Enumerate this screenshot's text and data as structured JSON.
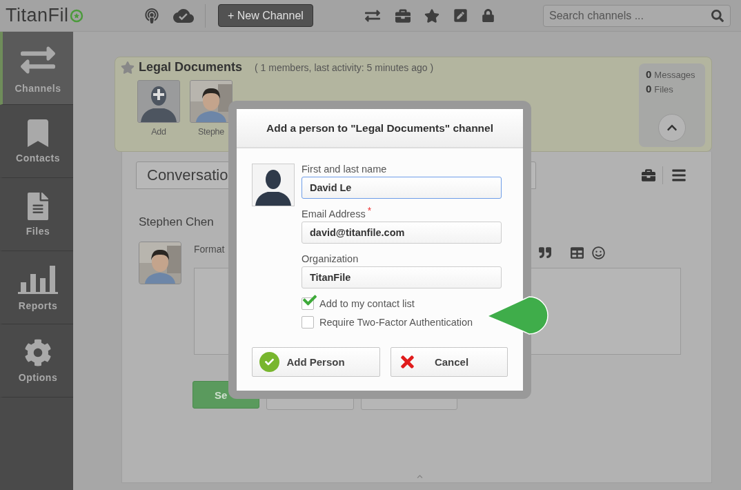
{
  "topbar": {
    "logo": "TitanFil",
    "new_channel_button": "+ New Channel",
    "search": {
      "placeholder": "Search channels ..."
    }
  },
  "sidebar": {
    "items": [
      {
        "kind": "channels",
        "label": "Channels",
        "selected": true
      },
      {
        "kind": "contacts",
        "label": "Contacts",
        "selected": false
      },
      {
        "kind": "files",
        "label": "Files",
        "selected": false
      },
      {
        "kind": "reports",
        "label": "Reports",
        "selected": false
      },
      {
        "kind": "options",
        "label": "Options",
        "selected": false
      }
    ]
  },
  "channel": {
    "title": "Legal Documents",
    "meta": "( 1 members, last activity: 5 minutes ago )",
    "members": [
      {
        "kind": "add",
        "label": "Add"
      },
      {
        "label": "Stephe"
      }
    ],
    "stats": [
      {
        "count": "0",
        "label": "Messages"
      },
      {
        "count": "0",
        "label": "Files"
      }
    ]
  },
  "conversation": {
    "tab": "Conversatio",
    "author": "Stephen Chen",
    "format_label": "Format",
    "send_button": "Se"
  },
  "dialog": {
    "title": "Add a person to \"Legal Documents\" channel",
    "fields": [
      {
        "label": "First and last name",
        "value": "David Le",
        "focused": true
      },
      {
        "label": "Email Address",
        "required_mark": "*",
        "value": "david@titanfile.com",
        "focused": false
      },
      {
        "label": "Organization",
        "value": "TitanFile",
        "focused": false
      }
    ],
    "checkboxes": [
      {
        "label": "Add to my contact list",
        "checked": true
      },
      {
        "label": "Require Two-Factor Authentication",
        "checked": false
      }
    ],
    "buttons": [
      {
        "kind": "confirm",
        "label": "Add Person"
      },
      {
        "kind": "cancel",
        "label": "Cancel"
      }
    ]
  }
}
